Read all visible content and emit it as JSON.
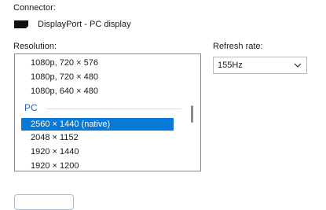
{
  "connector": {
    "label": "Connector:",
    "value": "DisplayPort - PC display",
    "icon": "displayport-icon"
  },
  "resolution": {
    "label": "Resolution:",
    "items": [
      "1080p, 720 × 576",
      "1080p, 720 × 480",
      "1080p, 640 × 480"
    ],
    "group_header": "PC",
    "selected": "2560 × 1440 (native)",
    "items_after": [
      "2048 × 1152",
      "1920 × 1440",
      "1920 × 1200"
    ]
  },
  "refresh_rate": {
    "label": "Refresh rate:",
    "value": "155Hz",
    "icon": "chevron-down-icon"
  },
  "colors": {
    "selection": "#0a78d7",
    "group_header": "#2f5fb8"
  }
}
